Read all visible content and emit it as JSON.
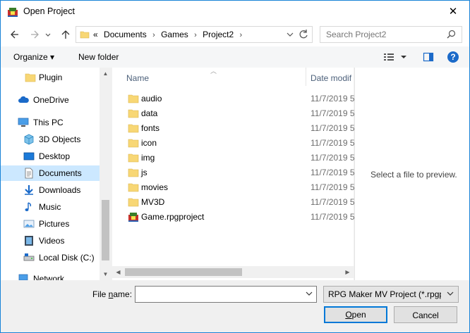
{
  "window": {
    "title": "Open Project",
    "close_glyph": "✕"
  },
  "nav": {
    "back_icon": "arrow-left-icon",
    "forward_icon": "arrow-right-icon",
    "recent_icon": "chevron-down-icon",
    "up_icon": "arrow-up-icon"
  },
  "address": {
    "overflow": "«",
    "crumbs": [
      "Documents",
      "Games",
      "Project2"
    ],
    "separator": "›"
  },
  "search": {
    "placeholder": "Search Project2"
  },
  "toolbar": {
    "organize": "Organize ▾",
    "new_folder": "New folder"
  },
  "sidebar": {
    "items": [
      {
        "label": "Plugin",
        "icon": "folder-icon"
      },
      {
        "label": "OneDrive",
        "icon": "cloud-icon"
      },
      {
        "label": "This PC",
        "icon": "computer-icon"
      },
      {
        "label": "3D Objects",
        "icon": "cube-icon"
      },
      {
        "label": "Desktop",
        "icon": "desktop-icon"
      },
      {
        "label": "Documents",
        "icon": "document-icon",
        "selected": true
      },
      {
        "label": "Downloads",
        "icon": "download-icon"
      },
      {
        "label": "Music",
        "icon": "music-icon"
      },
      {
        "label": "Pictures",
        "icon": "picture-icon"
      },
      {
        "label": "Videos",
        "icon": "video-icon"
      },
      {
        "label": "Local Disk (C:)",
        "icon": "drive-icon"
      },
      {
        "label": "Network",
        "icon": "network-icon"
      }
    ]
  },
  "files": {
    "columns": {
      "name": "Name",
      "date": "Date modif"
    },
    "rows": [
      {
        "name": "audio",
        "date": "11/7/2019 5",
        "icon": "folder-icon"
      },
      {
        "name": "data",
        "date": "11/7/2019 5",
        "icon": "folder-icon"
      },
      {
        "name": "fonts",
        "date": "11/7/2019 5",
        "icon": "folder-icon"
      },
      {
        "name": "icon",
        "date": "11/7/2019 5",
        "icon": "folder-icon"
      },
      {
        "name": "img",
        "date": "11/7/2019 5",
        "icon": "folder-icon"
      },
      {
        "name": "js",
        "date": "11/7/2019 5",
        "icon": "folder-icon"
      },
      {
        "name": "movies",
        "date": "11/7/2019 5",
        "icon": "folder-icon"
      },
      {
        "name": "MV3D",
        "date": "11/7/2019 5",
        "icon": "folder-icon"
      },
      {
        "name": "Game.rpgproject",
        "date": "11/7/2019 5",
        "icon": "rpg-project-icon"
      }
    ]
  },
  "preview": {
    "message": "Select a file to preview."
  },
  "bottom": {
    "file_name_label_pre": "File ",
    "file_name_label_u": "n",
    "file_name_label_post": "ame:",
    "file_name_value": "",
    "file_type": "RPG Maker MV Project (*.rpgproject)",
    "open_pre": "",
    "open_u": "O",
    "open_post": "pen",
    "cancel": "Cancel"
  },
  "colors": {
    "accent": "#0078d7",
    "selected": "#cce8ff",
    "folder": "#f8d775"
  }
}
